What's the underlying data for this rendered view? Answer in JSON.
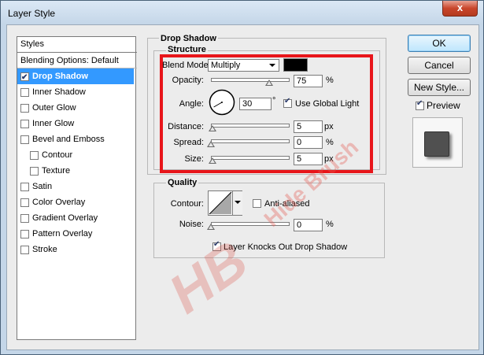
{
  "window": {
    "title": "Layer Style",
    "close_label": "x"
  },
  "styles_panel": {
    "header": "Styles",
    "blending_options": "Blending Options: Default",
    "items": [
      {
        "label": "Drop Shadow",
        "checked": true,
        "selected": true,
        "indent": false
      },
      {
        "label": "Inner Shadow",
        "checked": false,
        "selected": false,
        "indent": false
      },
      {
        "label": "Outer Glow",
        "checked": false,
        "selected": false,
        "indent": false
      },
      {
        "label": "Inner Glow",
        "checked": false,
        "selected": false,
        "indent": false
      },
      {
        "label": "Bevel and Emboss",
        "checked": false,
        "selected": false,
        "indent": false
      },
      {
        "label": "Contour",
        "checked": false,
        "selected": false,
        "indent": true
      },
      {
        "label": "Texture",
        "checked": false,
        "selected": false,
        "indent": true
      },
      {
        "label": "Satin",
        "checked": false,
        "selected": false,
        "indent": false
      },
      {
        "label": "Color Overlay",
        "checked": false,
        "selected": false,
        "indent": false
      },
      {
        "label": "Gradient Overlay",
        "checked": false,
        "selected": false,
        "indent": false
      },
      {
        "label": "Pattern Overlay",
        "checked": false,
        "selected": false,
        "indent": false
      },
      {
        "label": "Stroke",
        "checked": false,
        "selected": false,
        "indent": false
      }
    ]
  },
  "drop_shadow": {
    "section_title": "Drop Shadow",
    "structure_title": "Structure",
    "blend_mode_label": "Blend Mode:",
    "blend_mode_value": "Multiply",
    "shadow_color": "#000000",
    "opacity_label": "Opacity:",
    "opacity_value": "75",
    "opacity_unit": "%",
    "opacity_fraction": 0.75,
    "angle_label": "Angle:",
    "angle_value": "30",
    "angle_unit": "°",
    "use_global_light_label": "Use Global Light",
    "use_global_light": true,
    "distance_label": "Distance:",
    "distance_value": "5",
    "distance_unit": "px",
    "spread_label": "Spread:",
    "spread_value": "0",
    "spread_unit": "%",
    "size_label": "Size:",
    "size_value": "5",
    "size_unit": "px"
  },
  "quality": {
    "title": "Quality",
    "contour_label": "Contour:",
    "anti_aliased_label": "Anti-aliased",
    "anti_aliased": false,
    "noise_label": "Noise:",
    "noise_value": "0",
    "noise_unit": "%",
    "knocks_out_label": "Layer Knocks Out Drop Shadow",
    "knocks_out": true
  },
  "buttons": {
    "ok": "OK",
    "cancel": "Cancel",
    "new_style": "New Style...",
    "preview_label": "Preview",
    "preview_checked": true
  },
  "watermark": {
    "text": "Hide Brush",
    "logo": "HB"
  },
  "colors": {
    "highlight": "#e8151a",
    "selection": "#3399ff"
  }
}
